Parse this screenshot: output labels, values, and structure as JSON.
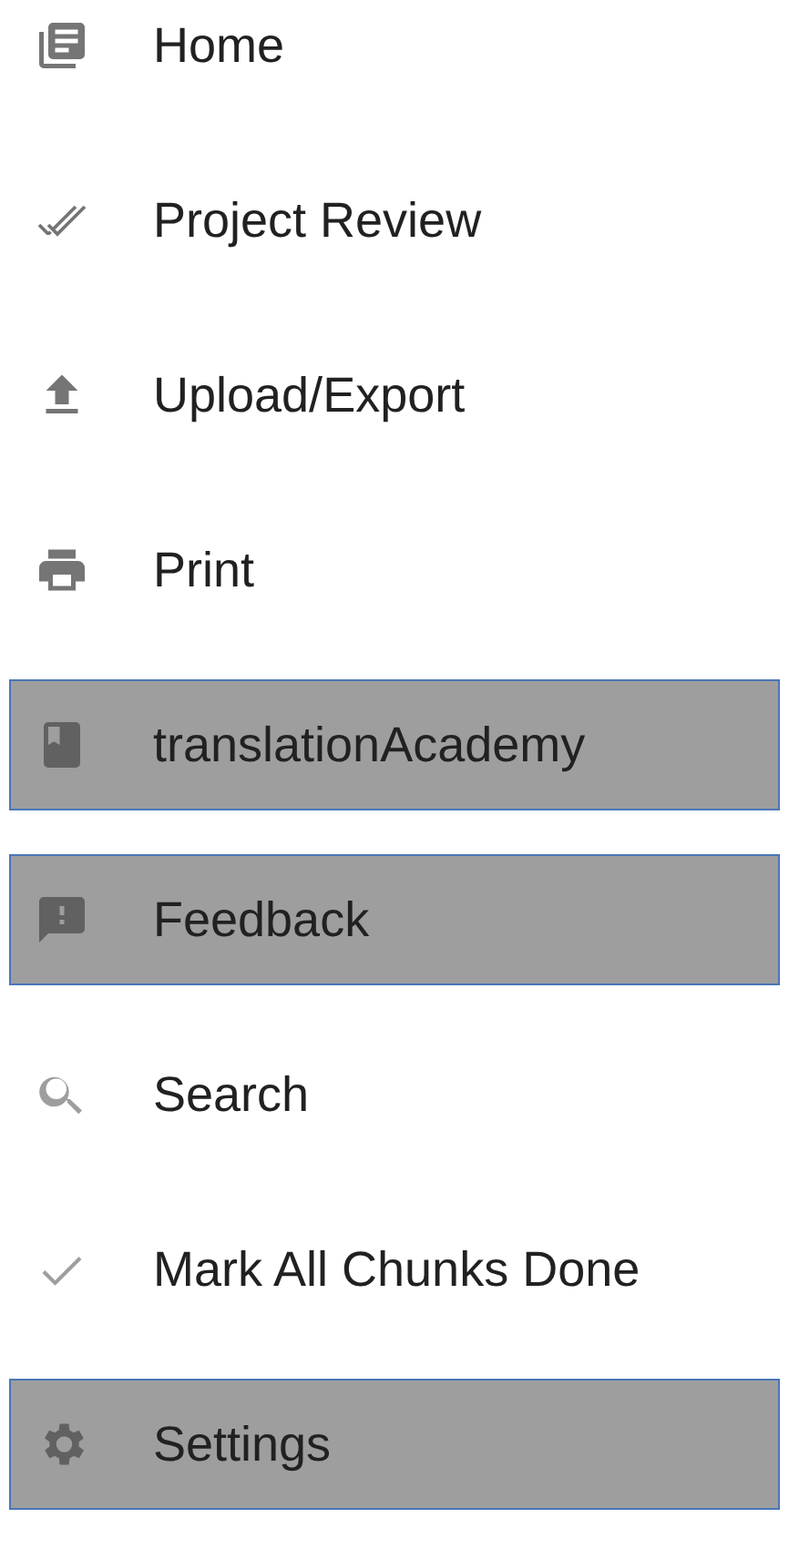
{
  "menu": {
    "items": [
      {
        "kind": "news",
        "label": "Home",
        "highlighted": false
      },
      {
        "kind": "doublecheck",
        "label": "Project Review",
        "highlighted": false
      },
      {
        "kind": "upload",
        "label": "Upload/Export",
        "highlighted": false
      },
      {
        "kind": "print",
        "label": "Print",
        "highlighted": false
      },
      {
        "kind": "book",
        "label": "translationAcademy",
        "highlighted": true
      },
      {
        "kind": "feedback",
        "label": "Feedback",
        "highlighted": true
      },
      {
        "kind": "search",
        "label": "Search",
        "highlighted": false
      },
      {
        "kind": "check",
        "label": "Mark All Chunks Done",
        "highlighted": false
      },
      {
        "kind": "gear",
        "label": "Settings",
        "highlighted": true
      }
    ]
  }
}
